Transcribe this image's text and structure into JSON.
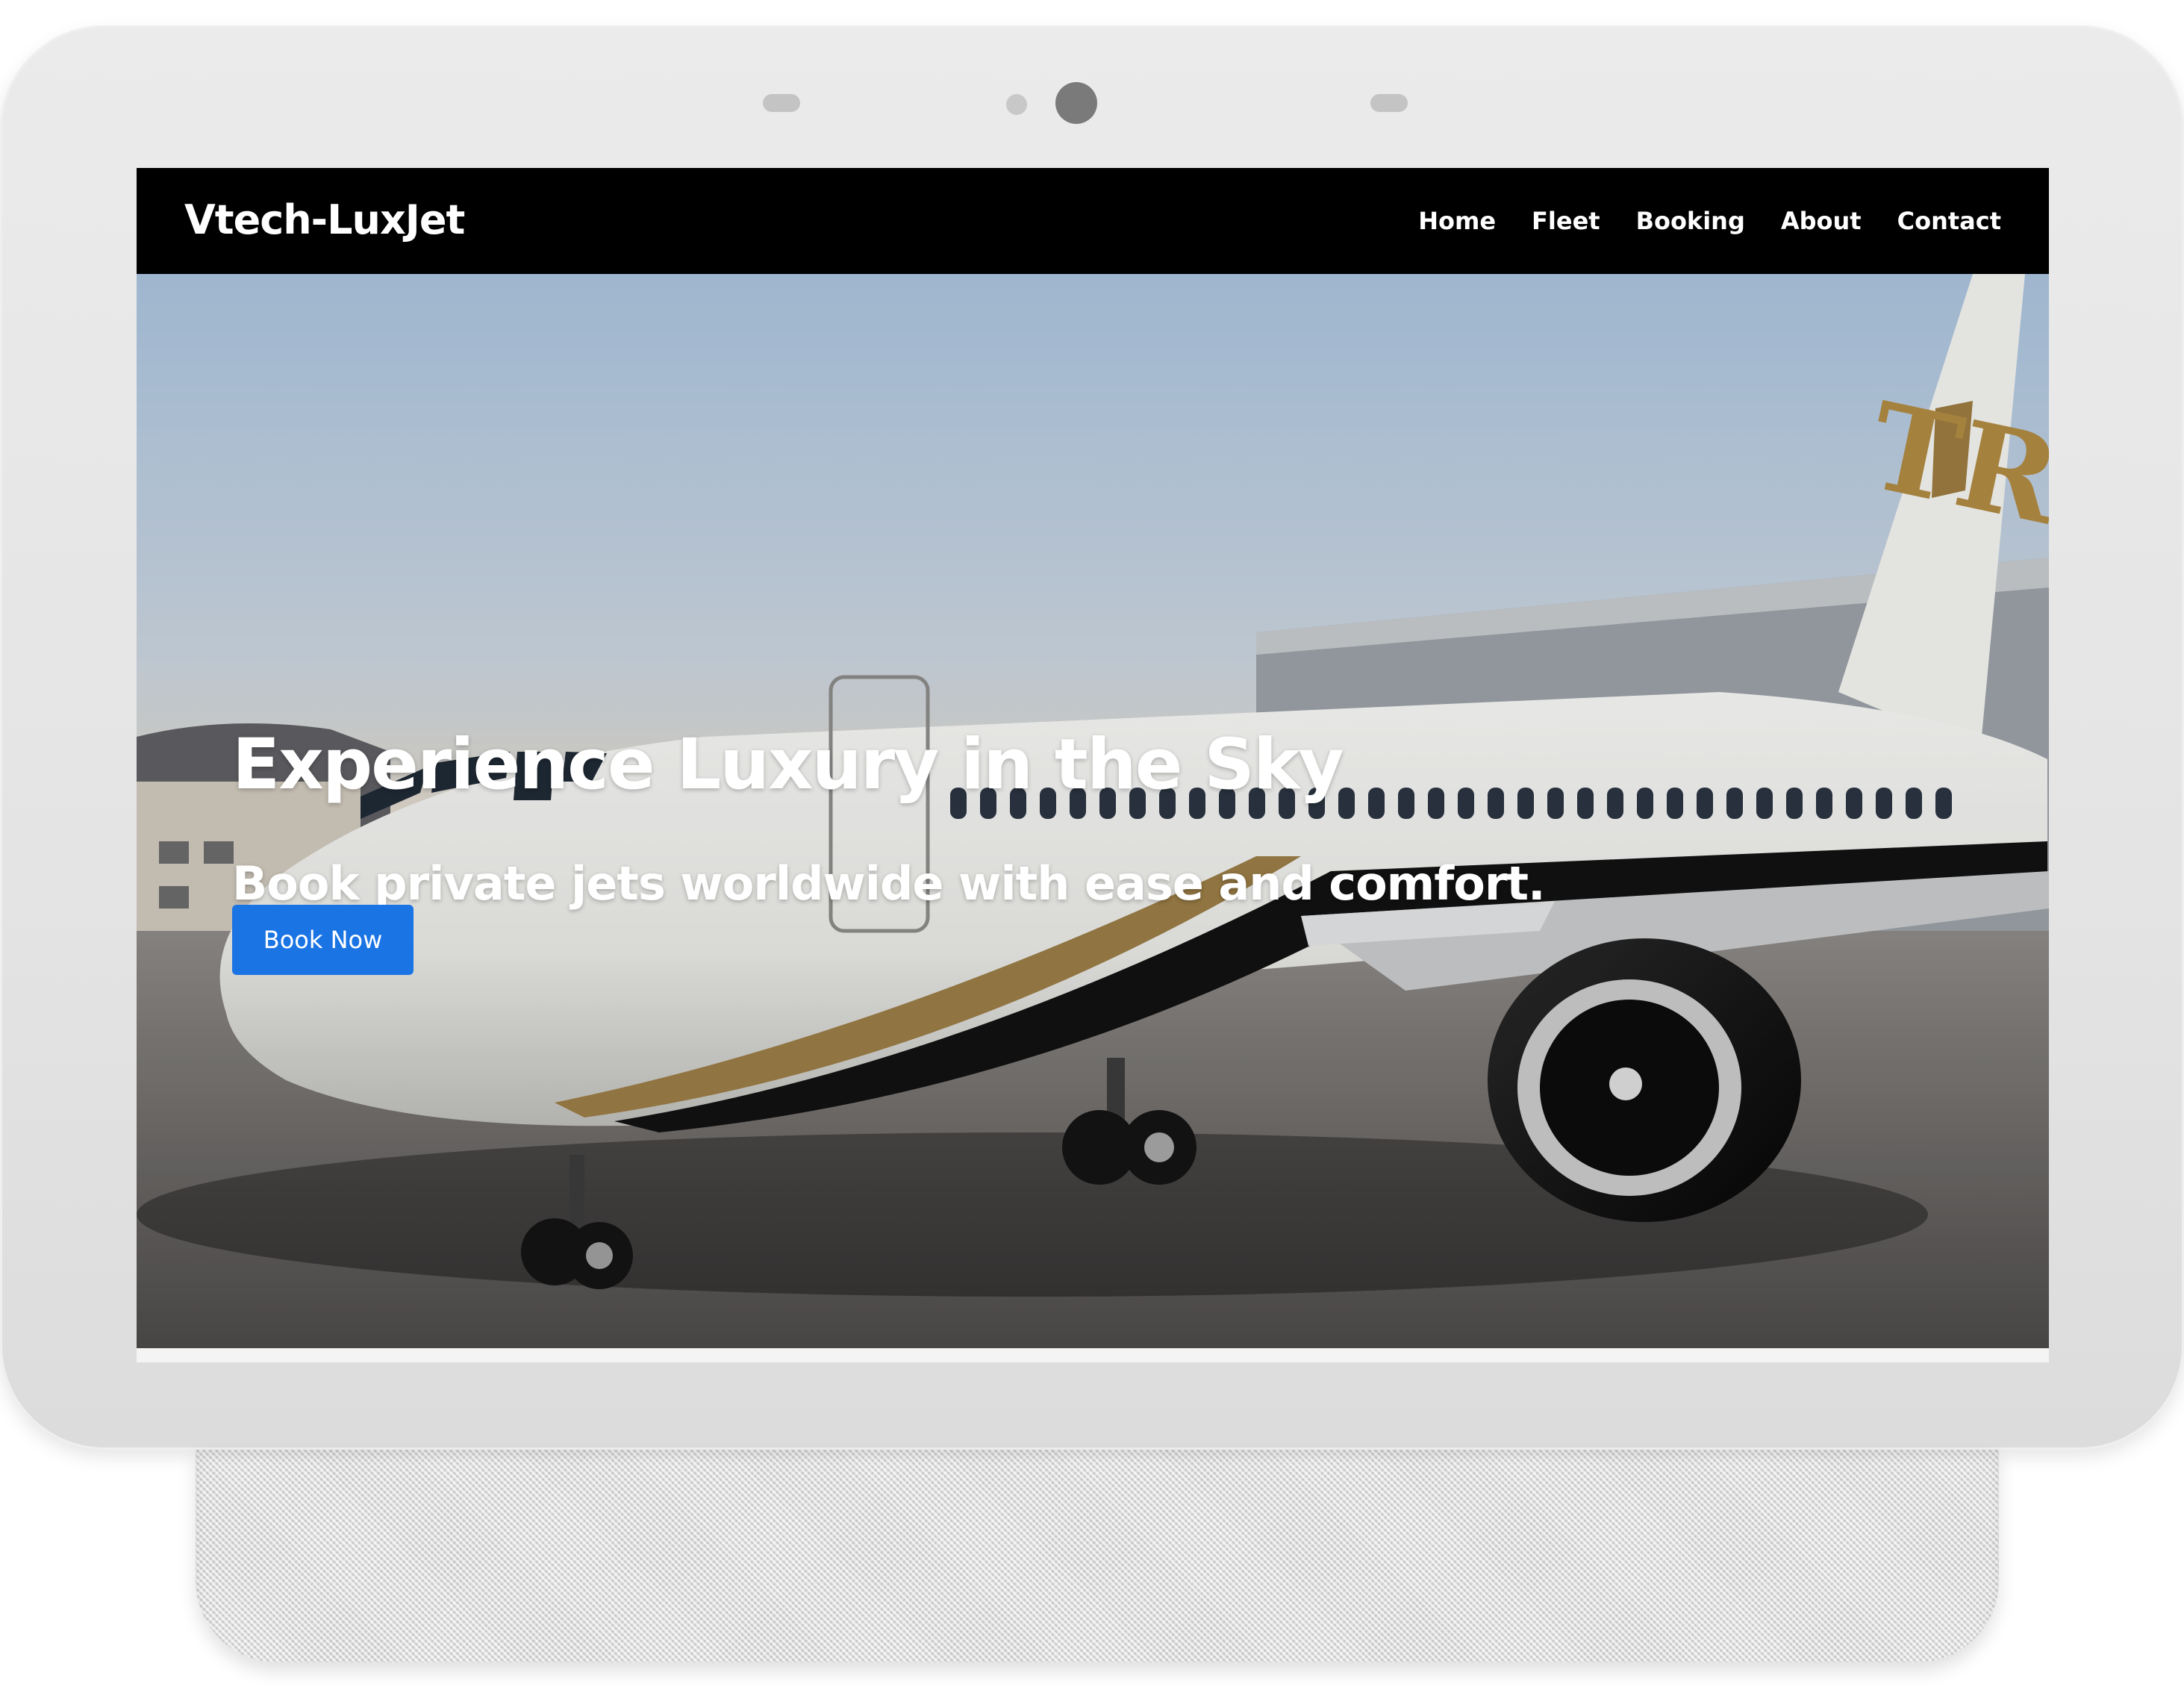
{
  "site": {
    "brand": "Vtech-LuxJet",
    "nav": [
      "Home",
      "Fleet",
      "Booking",
      "About",
      "Contact"
    ]
  },
  "hero": {
    "title": "Experience Luxury in the Sky",
    "subtitle": "Book private jets worldwide with ease and comfort.",
    "cta": "Book Now",
    "image": "private-jet-on-tarmac",
    "tail_logo": "TR"
  },
  "colors": {
    "navbar": "#000000",
    "cta": "#1b74e4",
    "text": "#ffffff"
  }
}
